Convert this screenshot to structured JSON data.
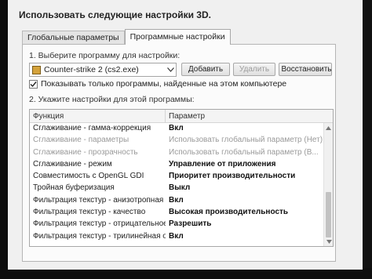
{
  "heading": "Использовать следующие настройки 3D.",
  "tabs": [
    {
      "label": "Глобальные параметры",
      "active": false
    },
    {
      "label": "Программные настройки",
      "active": true
    }
  ],
  "step1_label": "1. Выберите программу для настройки:",
  "program_select": {
    "value": "Counter-strike 2 (cs2.exe)"
  },
  "buttons": {
    "add": "Добавить",
    "remove": "Удалить",
    "restore": "Восстановить"
  },
  "show_only_checkbox": {
    "label": "Показывать только программы, найденные на этом компьютере",
    "checked": true
  },
  "step2_label": "2. Укажите настройки для этой программы:",
  "table": {
    "headers": [
      "Функция",
      "Параметр"
    ],
    "rows": [
      {
        "feature": "Сглаживание - гамма-коррекция",
        "value": "Вкл",
        "grey": false,
        "bold": true
      },
      {
        "feature": "Сглаживание - параметры",
        "value": "Использовать глобальный параметр (Нет)",
        "grey": true,
        "bold": false
      },
      {
        "feature": "Сглаживание - прозрачность",
        "value": "Использовать глобальный параметр (В...",
        "grey": true,
        "bold": false
      },
      {
        "feature": "Сглаживание - режим",
        "value": "Управление от приложения",
        "grey": false,
        "bold": true
      },
      {
        "feature": "Совместимость с OpenGL GDI",
        "value": "Приоритет производительности",
        "grey": false,
        "bold": true
      },
      {
        "feature": "Тройная буферизация",
        "value": "Выкл",
        "grey": false,
        "bold": true
      },
      {
        "feature": "Фильтрация текстур - анизотропная опт...",
        "value": "Вкл",
        "grey": false,
        "bold": true
      },
      {
        "feature": "Фильтрация текстур - качество",
        "value": "Высокая производительность",
        "grey": false,
        "bold": true
      },
      {
        "feature": "Фильтрация текстур - отрицательное о...",
        "value": "Разрешить",
        "grey": false,
        "bold": true
      },
      {
        "feature": "Фильтрация текстур - трилинейная опт...",
        "value": "Вкл",
        "grey": false,
        "bold": true
      }
    ]
  },
  "icons": {
    "program": "program-icon",
    "dropdown": "chevron-down-icon",
    "restore": "nvidia-icon",
    "check": "checkmark-icon"
  }
}
